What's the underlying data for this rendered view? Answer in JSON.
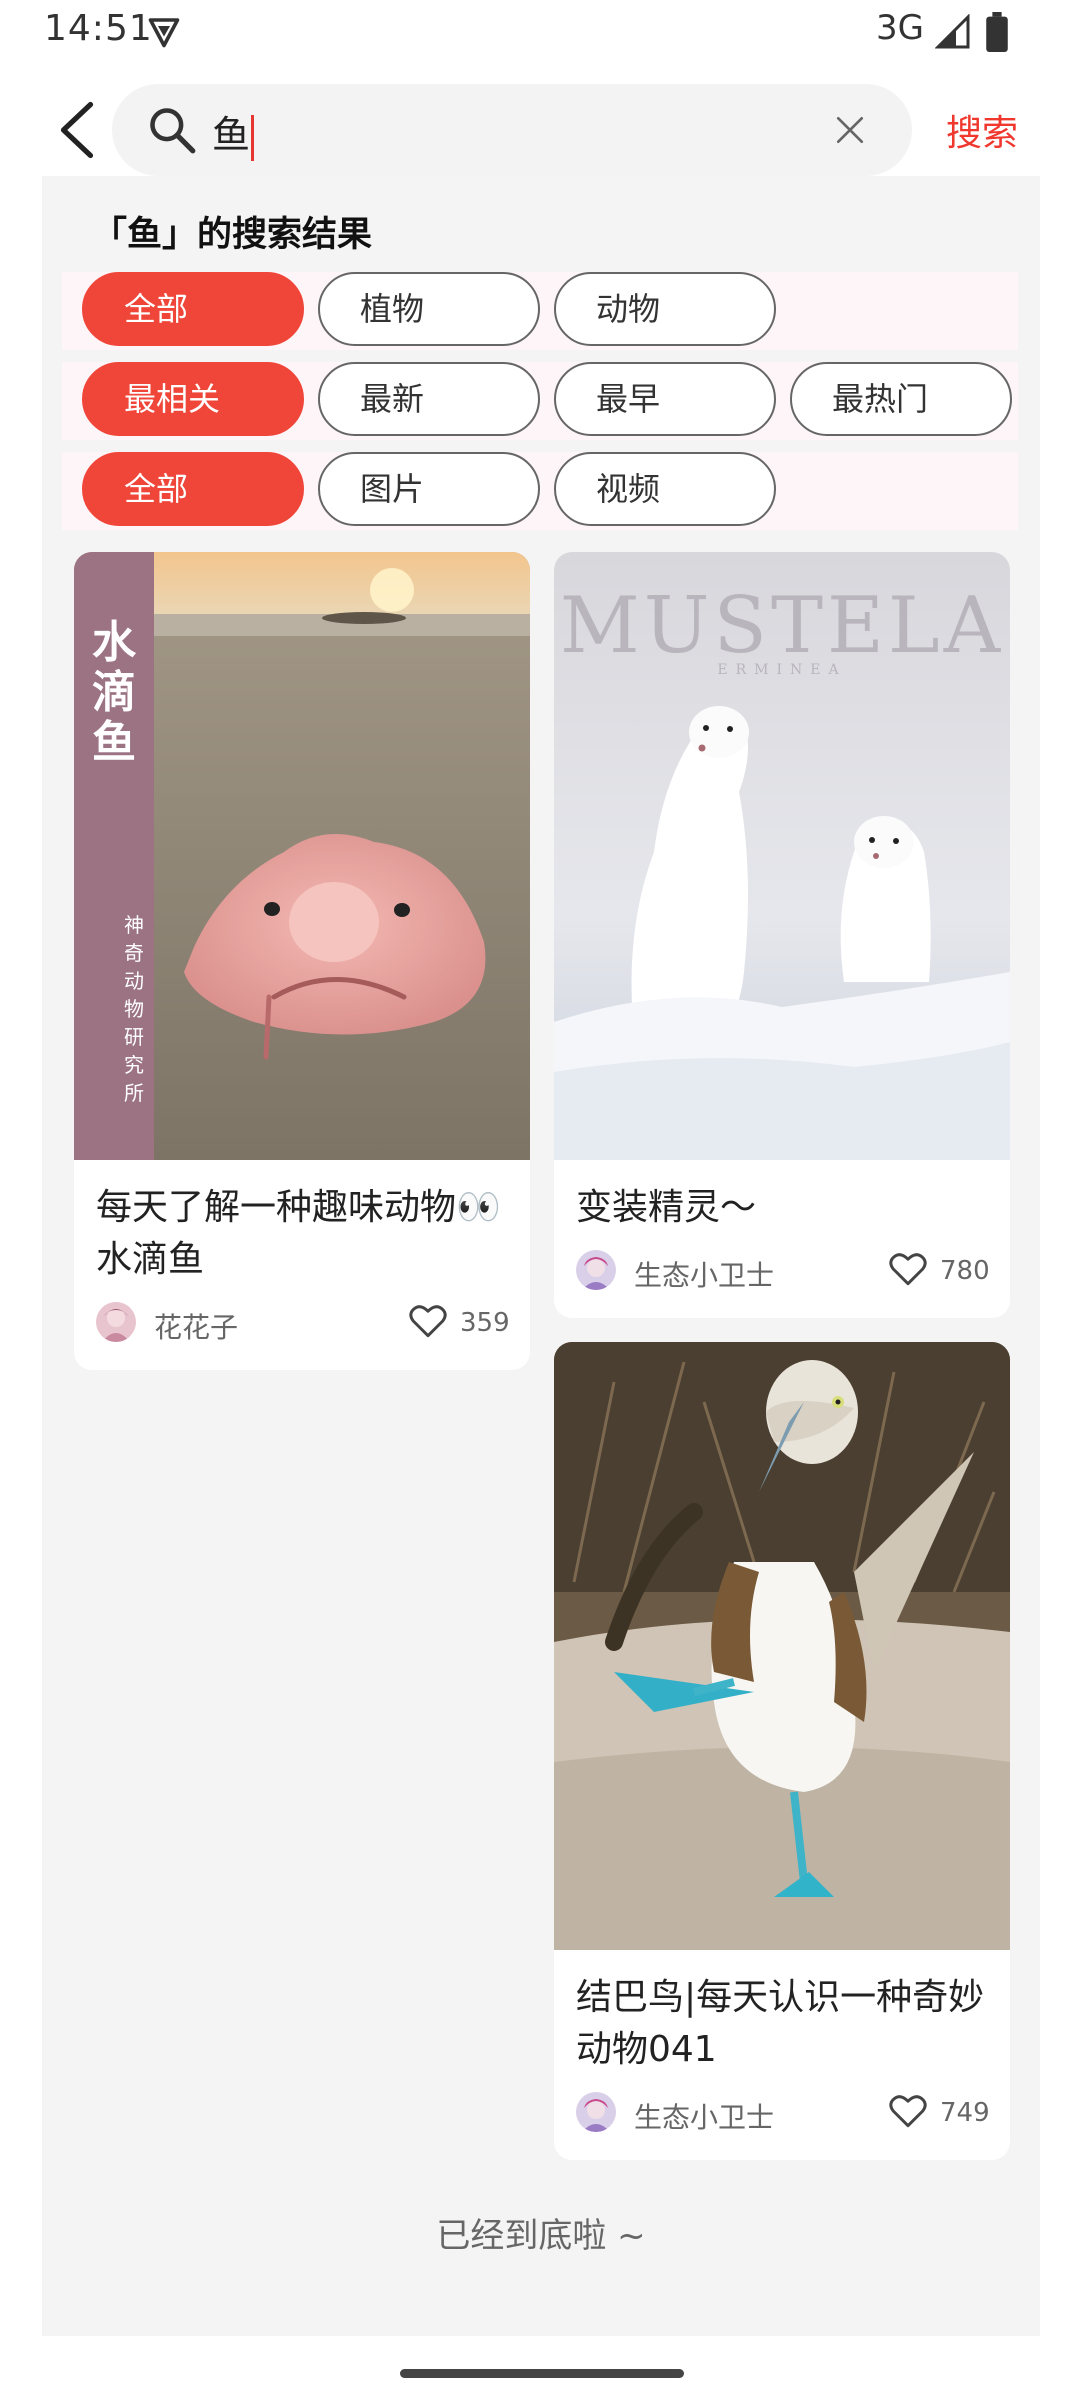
{
  "status_bar": {
    "time": "14:51",
    "network": "3G"
  },
  "search": {
    "query": "鱼",
    "submit_label": "搜索"
  },
  "result_title": "「鱼」的搜索结果",
  "filters": {
    "category": [
      "全部",
      "植物",
      "动物"
    ],
    "sort": [
      "最相关",
      "最新",
      "最早",
      "最热门"
    ],
    "media": [
      "全部",
      "图片",
      "视频"
    ],
    "active": {
      "category": "全部",
      "sort": "最相关",
      "media": "全部"
    }
  },
  "cards": [
    {
      "title": "每天了解一种趣味动物👀水滴鱼",
      "image_caption": "水滴鱼",
      "image_side_text": "神奇动物研究所",
      "author": "花花子",
      "likes": "359"
    },
    {
      "title": "变装精灵～",
      "image_caption": "MUSTELA",
      "image_subcaption": "ERMINEA",
      "author": "生态小卫士",
      "likes": "780"
    },
    {
      "title": "结巴鸟|每天认识一种奇妙动物041",
      "author": "生态小卫士",
      "likes": "749"
    }
  ],
  "end_message": "已经到底啦 ~",
  "colors": {
    "accent": "#f0382f",
    "chip_active": "#f0463a"
  }
}
